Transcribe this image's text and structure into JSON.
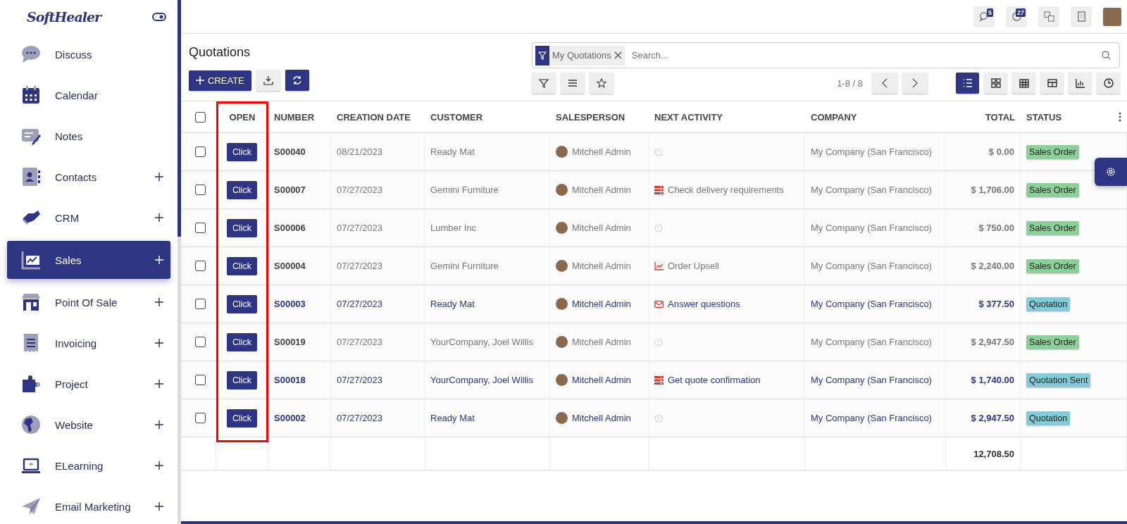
{
  "sidebar": {
    "logo": "SoftHealer",
    "items": [
      {
        "label": "Discuss",
        "expandable": false,
        "selected": false
      },
      {
        "label": "Calendar",
        "expandable": false,
        "selected": false
      },
      {
        "label": "Notes",
        "expandable": false,
        "selected": false
      },
      {
        "label": "Contacts",
        "expandable": true,
        "selected": false
      },
      {
        "label": "CRM",
        "expandable": true,
        "selected": false
      },
      {
        "label": "Sales",
        "expandable": true,
        "selected": true
      },
      {
        "label": "Point Of Sale",
        "expandable": true,
        "selected": false
      },
      {
        "label": "Invoicing",
        "expandable": true,
        "selected": false
      },
      {
        "label": "Project",
        "expandable": true,
        "selected": false
      },
      {
        "label": "Website",
        "expandable": true,
        "selected": false
      },
      {
        "label": "ELearning",
        "expandable": true,
        "selected": false
      },
      {
        "label": "Email Marketing",
        "expandable": true,
        "selected": false
      }
    ]
  },
  "topbar": {
    "messages_count": "5",
    "activities_count": "27"
  },
  "page": {
    "title": "Quotations",
    "create_label": "CREATE"
  },
  "search": {
    "facet": "My Quotations",
    "placeholder": "Search..."
  },
  "pager": "1-8 / 8",
  "views": [
    {
      "kind": "list",
      "selected": true
    },
    {
      "kind": "kanban",
      "selected": false
    },
    {
      "kind": "calendar",
      "selected": false
    },
    {
      "kind": "pivot",
      "selected": false
    },
    {
      "kind": "graph",
      "selected": false
    },
    {
      "kind": "activity",
      "selected": false
    }
  ],
  "table": {
    "select_all_checked": false,
    "columns": [
      "OPEN",
      "NUMBER",
      "CREATION DATE",
      "CUSTOMER",
      "SALESPERSON",
      "NEXT ACTIVITY",
      "COMPANY",
      "TOTAL",
      "STATUS"
    ],
    "rows": [
      {
        "checked": false,
        "open": "Click",
        "number": "S00040",
        "date": "08/21/2023",
        "customer": "Ready Mat",
        "salesperson": "Mitchell Admin",
        "activity": {
          "kind": "none"
        },
        "company": "My Company (San Francisco)",
        "total": "$ 0.00",
        "status": {
          "label": "Sales Order",
          "kind": "sale"
        }
      },
      {
        "checked": false,
        "open": "Click",
        "number": "S00007",
        "date": "07/27/2023",
        "customer": "Gemini Furniture",
        "salesperson": "Mitchell Admin",
        "activity": {
          "kind": "todo",
          "label": "Check delivery requirements"
        },
        "company": "My Company (San Francisco)",
        "total": "$ 1,706.00",
        "status": {
          "label": "Sales Order",
          "kind": "sale"
        }
      },
      {
        "checked": false,
        "open": "Click",
        "number": "S00006",
        "date": "07/27/2023",
        "customer": "Lumber Inc",
        "salesperson": "Mitchell Admin",
        "activity": {
          "kind": "none"
        },
        "company": "My Company (San Francisco)",
        "total": "$ 750.00",
        "status": {
          "label": "Sales Order",
          "kind": "sale"
        }
      },
      {
        "checked": false,
        "open": "Click",
        "number": "S00004",
        "date": "07/27/2023",
        "customer": "Gemini Furniture",
        "salesperson": "Mitchell Admin",
        "activity": {
          "kind": "upsell",
          "label": "Order Upsell"
        },
        "company": "My Company (San Francisco)",
        "total": "$ 2,240.00",
        "status": {
          "label": "Sales Order",
          "kind": "sale"
        }
      },
      {
        "checked": false,
        "open": "Click",
        "number": "S00003",
        "date": "07/27/2023",
        "customer": "Ready Mat",
        "salesperson": "Mitchell Admin",
        "activity": {
          "kind": "email",
          "label": "Answer questions"
        },
        "company": "My Company (San Francisco)",
        "total": "$ 377.50",
        "status": {
          "label": "Quotation",
          "kind": "draft"
        }
      },
      {
        "checked": false,
        "open": "Click",
        "number": "S00019",
        "date": "07/27/2023",
        "customer": "YourCompany, Joel Willis",
        "salesperson": "Mitchell Admin",
        "activity": {
          "kind": "none"
        },
        "company": "My Company (San Francisco)",
        "total": "$ 2,947.50",
        "status": {
          "label": "Sales Order",
          "kind": "sale"
        }
      },
      {
        "checked": false,
        "open": "Click",
        "number": "S00018",
        "date": "07/27/2023",
        "customer": "YourCompany, Joel Willis",
        "salesperson": "Mitchell Admin",
        "activity": {
          "kind": "todo",
          "label": "Get quote confirmation"
        },
        "company": "My Company (San Francisco)",
        "total": "$ 1,740.00",
        "status": {
          "label": "Quotation Sent",
          "kind": "sent"
        }
      },
      {
        "checked": false,
        "open": "Click",
        "number": "S00002",
        "date": "07/27/2023",
        "customer": "Ready Mat",
        "salesperson": "Mitchell Admin",
        "activity": {
          "kind": "none"
        },
        "company": "My Company (San Francisco)",
        "total": "$ 2,947.50",
        "status": {
          "label": "Quotation",
          "kind": "draft"
        }
      }
    ],
    "sum_total": "12,708.50"
  }
}
